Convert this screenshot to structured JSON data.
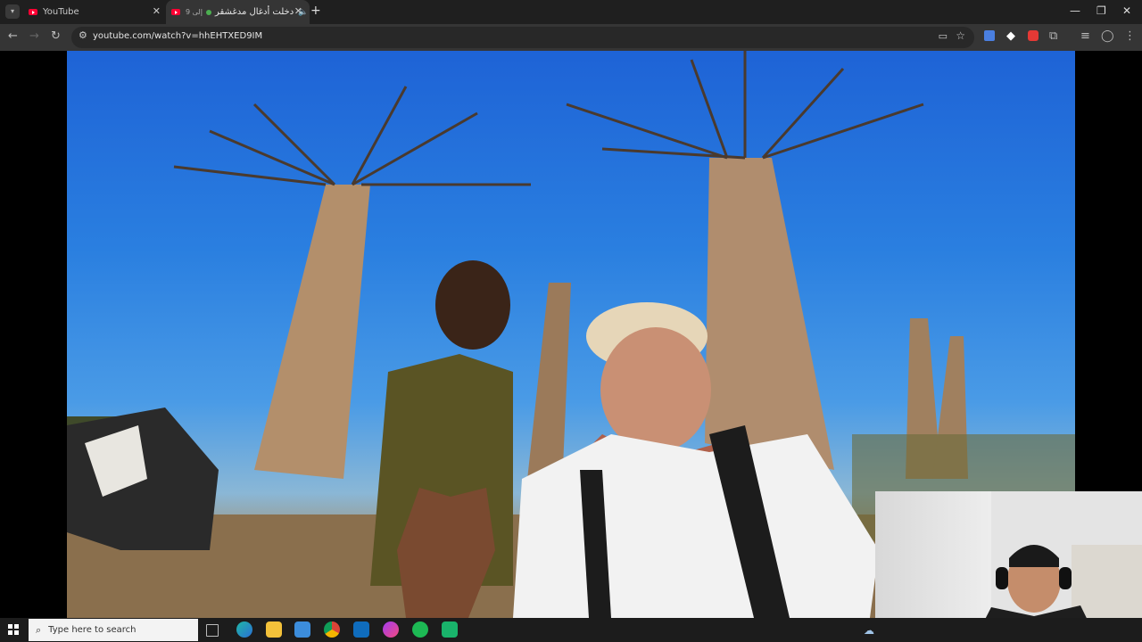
{
  "browser": {
    "tabs": [
      {
        "title": "YouTube",
        "active": false
      },
      {
        "title": "دخلت أدغال مدغشقر",
        "active": true
      }
    ],
    "tab_prefix": "9 إلى",
    "url": "youtube.com/watch?v=hhEHTXED9IM"
  },
  "taskbar": {
    "search_placeholder": "Type here to search"
  },
  "colors": {
    "youtube_red": "#ff0033",
    "sky": "#2a7fe0"
  }
}
